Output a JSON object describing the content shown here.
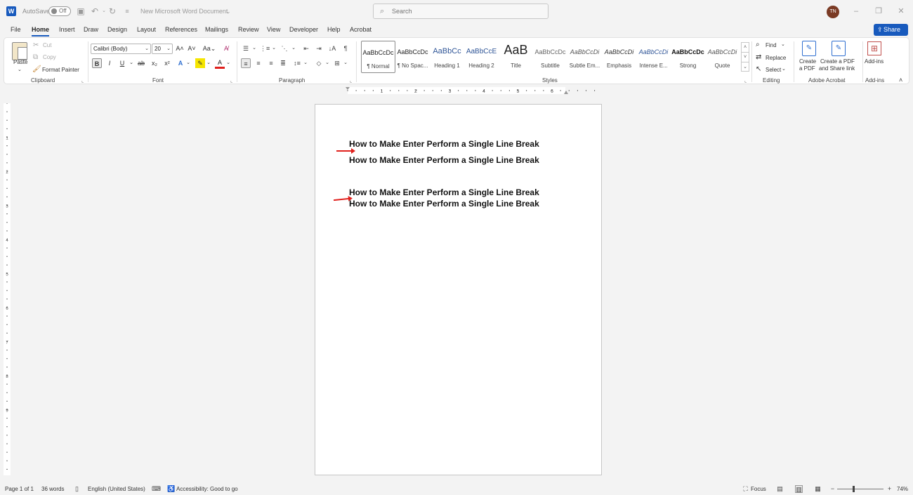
{
  "titlebar": {
    "autosave_label": "AutoSave",
    "autosave_state": "Off",
    "doc_title": "New Microsoft Word Document",
    "search_placeholder": "Search",
    "avatar_initials": "TN"
  },
  "tabs": [
    "File",
    "Home",
    "Insert",
    "Draw",
    "Design",
    "Layout",
    "References",
    "Mailings",
    "Review",
    "View",
    "Developer",
    "Help",
    "Acrobat"
  ],
  "active_tab": "Home",
  "share_label": "Share",
  "clipboard": {
    "paste": "Paste",
    "cut": "Cut",
    "copy": "Copy",
    "format_painter": "Format Painter",
    "label": "Clipboard"
  },
  "font": {
    "family": "Calibri (Body)",
    "size": "20",
    "label": "Font"
  },
  "paragraph": {
    "label": "Paragraph"
  },
  "styles": {
    "label": "Styles",
    "items": [
      {
        "preview": "AaBbCcDc",
        "name": "¶ Normal",
        "color": "#222222"
      },
      {
        "preview": "AaBbCcDc",
        "name": "¶ No Spac...",
        "color": "#222222"
      },
      {
        "preview": "AaBbCc",
        "name": "Heading 1",
        "color": "#2f5597"
      },
      {
        "preview": "AaBbCcE",
        "name": "Heading 2",
        "color": "#2f5597"
      },
      {
        "preview": "AaB",
        "name": "Title",
        "color": "#222222"
      },
      {
        "preview": "AaBbCcDc",
        "name": "Subtitle",
        "color": "#666666"
      },
      {
        "preview": "AaBbCcDi",
        "name": "Subtle Em...",
        "color": "#555555"
      },
      {
        "preview": "AaBbCcDi",
        "name": "Emphasis",
        "color": "#333333"
      },
      {
        "preview": "AaBbCcDi",
        "name": "Intense E...",
        "color": "#2f5597"
      },
      {
        "preview": "AaBbCcDc",
        "name": "Strong",
        "color": "#111111"
      },
      {
        "preview": "AaBbCcDi",
        "name": "Quote",
        "color": "#555555"
      }
    ]
  },
  "editing": {
    "find": "Find",
    "replace": "Replace",
    "select": "Select",
    "label": "Editing"
  },
  "acrobat": {
    "create_pdf_line1": "Create",
    "create_pdf_line2": "a PDF",
    "share_link_line1": "Create a PDF",
    "share_link_line2": "and Share link",
    "label": "Adobe Acrobat"
  },
  "addins": {
    "button": "Add-ins",
    "label": "Add-ins"
  },
  "document": {
    "lines": [
      "How to Make Enter Perform a Single Line Break",
      "How to Make Enter Perform a Single Line Break",
      "How to Make Enter Perform a Single Line Break",
      "How to Make Enter Perform a Single Line Break"
    ]
  },
  "ruler": {
    "h_numbers": [
      "1",
      "2",
      "3",
      "4",
      "5",
      "6"
    ],
    "v_numbers": [
      "1",
      "2",
      "3",
      "4",
      "5",
      "6",
      "7",
      "8",
      "9"
    ]
  },
  "statusbar": {
    "page": "Page 1 of 1",
    "words": "36 words",
    "language": "English (United States)",
    "accessibility": "Accessibility: Good to go",
    "focus": "Focus",
    "zoom": "74%"
  }
}
